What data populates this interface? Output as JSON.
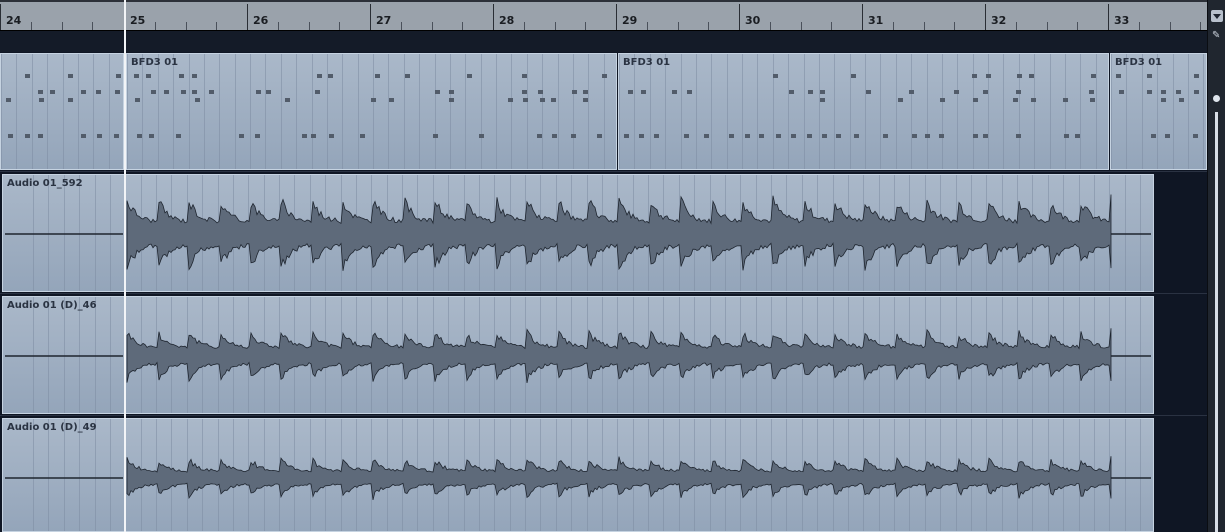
{
  "ruler": {
    "bars": [
      "24",
      "25",
      "26",
      "27",
      "28",
      "29",
      "30",
      "31",
      "32",
      "33"
    ]
  },
  "midi_track": {
    "parts": [
      {
        "name": ""
      },
      {
        "name": "BFD3 01"
      },
      {
        "name": "BFD3 01"
      },
      {
        "name": "BFD3 01"
      }
    ]
  },
  "audio_tracks": [
    {
      "event_name": "Audio 01_592"
    },
    {
      "event_name": "Audio 01 (D)_46"
    },
    {
      "event_name": "Audio 01 (D)_49"
    }
  ],
  "colors": {
    "part_fill": "#9fb0c4",
    "waveform": "#5e6a7a",
    "waveform_outline": "#1e252f",
    "background": "#0e1522"
  },
  "scrollbar": {
    "menu_icon": "chevron-down-icon",
    "tool_icon": "pencil-icon"
  }
}
